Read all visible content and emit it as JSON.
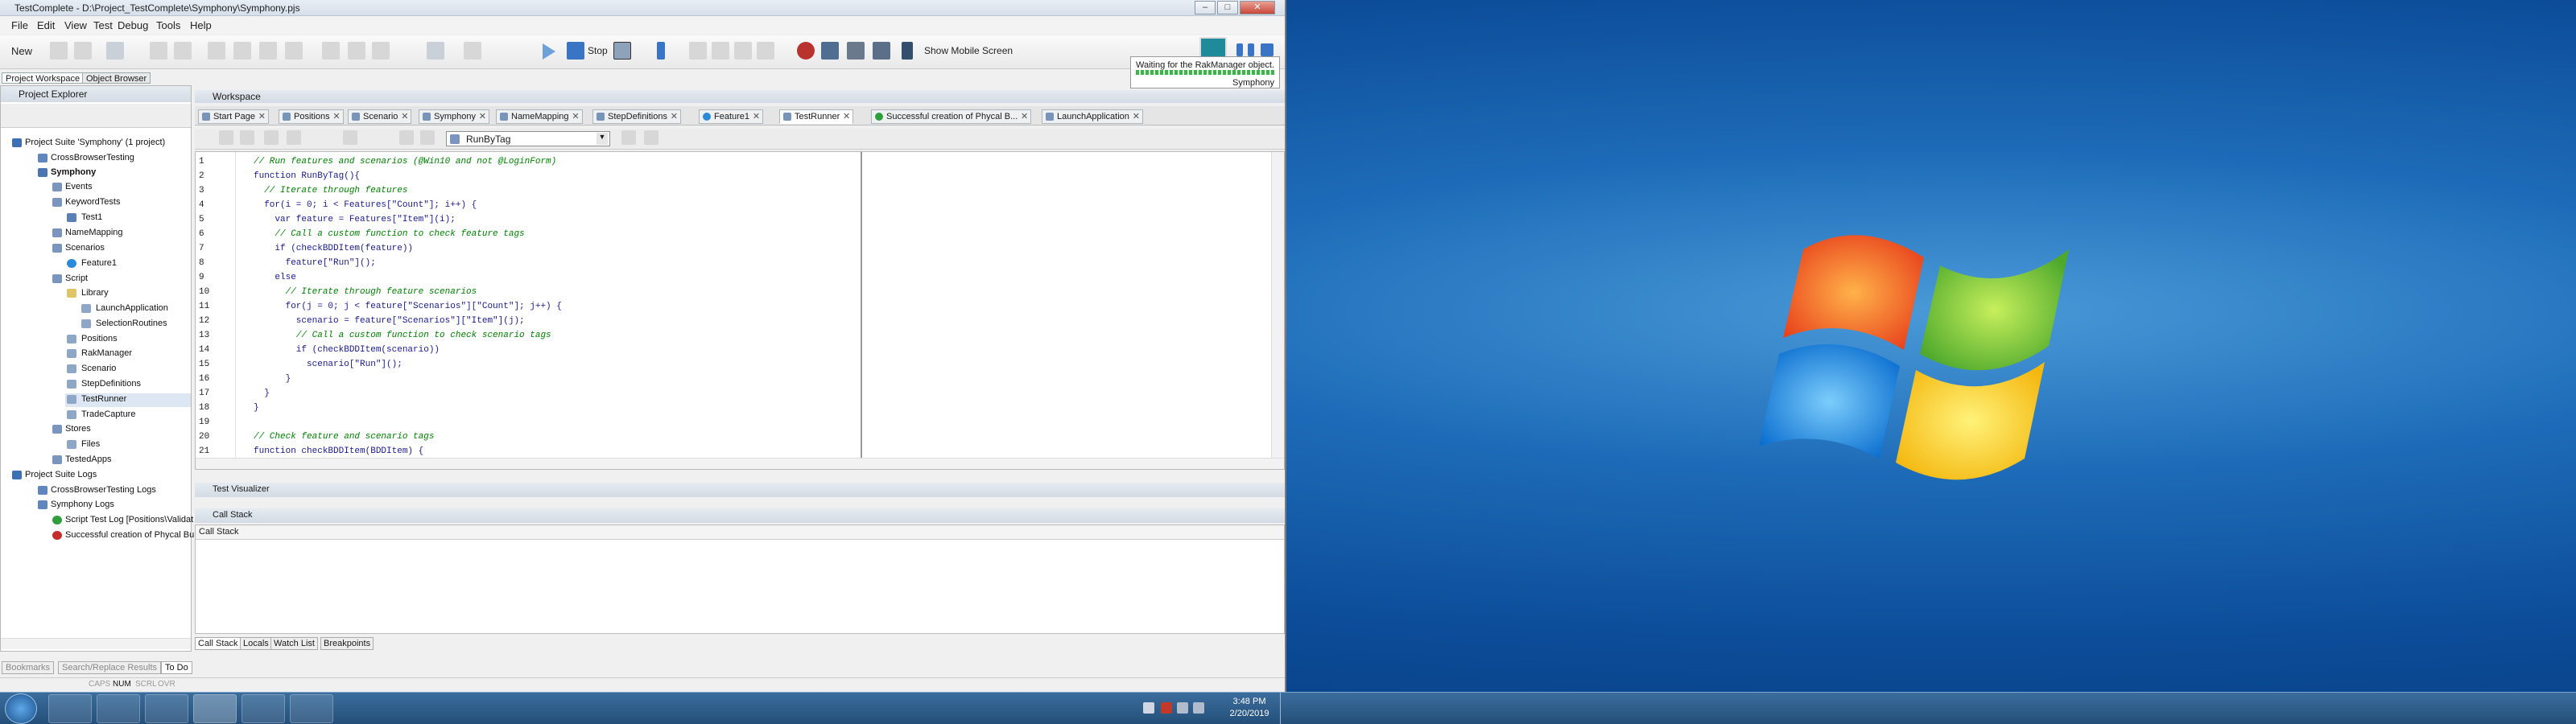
{
  "window": {
    "title": "TestComplete - D:\\Project_TestComplete\\Symphony\\Symphony.pjs",
    "btn_min": "–",
    "btn_max": "□",
    "btn_close": "✕"
  },
  "menubar": {
    "items": [
      "File",
      "Edit",
      "View",
      "Test",
      "Debug",
      "Tools",
      "Help"
    ]
  },
  "toolbar": {
    "new_label": "New",
    "stop_label": "Stop",
    "mobile_label": "Show Mobile Screen"
  },
  "notification": {
    "line1": "Waiting for the RakManager object.",
    "line2": "Symphony"
  },
  "panel_tabs": [
    "Project Workspace",
    "Object Browser"
  ],
  "project_explorer": {
    "title": "Project Explorer",
    "tree": [
      {
        "label": "Project Suite 'Symphony' (1 project)"
      },
      {
        "label": "CrossBrowserTesting"
      },
      {
        "label": "Symphony"
      },
      {
        "label": "Events"
      },
      {
        "label": "KeywordTests"
      },
      {
        "label": "Test1"
      },
      {
        "label": "NameMapping"
      },
      {
        "label": "Scenarios"
      },
      {
        "label": "Feature1"
      },
      {
        "label": "Script"
      },
      {
        "label": "Library"
      },
      {
        "label": "LaunchApplication"
      },
      {
        "label": "SelectionRoutines"
      },
      {
        "label": "Positions"
      },
      {
        "label": "RakManager"
      },
      {
        "label": "Scenario"
      },
      {
        "label": "StepDefinitions"
      },
      {
        "label": "TestRunner"
      },
      {
        "label": "TradeCapture"
      },
      {
        "label": "Stores"
      },
      {
        "label": "Files"
      },
      {
        "label": "TestedApps"
      },
      {
        "label": "Project Suite Logs"
      },
      {
        "label": "CrossBrowserTesting Logs"
      },
      {
        "label": "Symphony Logs"
      },
      {
        "label": "Script Test Log [Positions\\Validat"
      },
      {
        "label": "Successful creation of Phycal Bu"
      }
    ]
  },
  "workspace": {
    "title": "Workspace",
    "tabs": [
      {
        "label": "Start Page"
      },
      {
        "label": "Positions"
      },
      {
        "label": "Scenario"
      },
      {
        "label": "Symphony"
      },
      {
        "label": "NameMapping"
      },
      {
        "label": "StepDefinitions"
      },
      {
        "label": "Feature1"
      },
      {
        "label": "TestRunner"
      },
      {
        "label": "Successful creation of Phycal B..."
      },
      {
        "label": "LaunchApplication"
      }
    ],
    "routine": "RunByTag"
  },
  "editor": {
    "line_numbers": [
      "1",
      "2",
      "3",
      "4",
      "5",
      "6",
      "7",
      "8",
      "9",
      "10",
      "11",
      "12",
      "13",
      "14",
      "15",
      "16",
      "17",
      "18",
      "19",
      "20",
      "21"
    ],
    "lines": [
      "// Run features and scenarios (@Win10 and not @LoginForm)",
      "function RunByTag(){",
      "  // Iterate through features",
      "  for(i = 0; i < Features[\"Count\"]; i++) {",
      "    var feature = Features[\"Item\"](i);",
      "    // Call a custom function to check feature tags",
      "    if (checkBDDItem(feature))",
      "      feature[\"Run\"]();",
      "    else",
      "      // Iterate through feature scenarios",
      "      for(j = 0; j < feature[\"Scenarios\"][\"Count\"]; j++) {",
      "        scenario = feature[\"Scenarios\"][\"Item\"](j);",
      "        // Call a custom function to check scenario tags",
      "        if (checkBDDItem(scenario))",
      "          scenario[\"Run\"]();",
      "      }",
      "  }",
      "}",
      "",
      "// Check feature and scenario tags",
      "function checkBDDItem(BDDItem) {"
    ]
  },
  "test_visualizer": "Test Visualizer",
  "call_stack": {
    "title": "Call Stack",
    "column": "Call Stack"
  },
  "bottom_tabs": [
    "Call Stack",
    "Locals",
    "Watch List",
    "Breakpoints"
  ],
  "lower_tabs": [
    "Bookmarks",
    "Search/Replace Results",
    "To Do"
  ],
  "status": [
    "CAPS",
    "NUM",
    "SCRL",
    "OVR"
  ],
  "taskbar": {
    "time": "3:48 PM",
    "date": "2/20/2019"
  }
}
